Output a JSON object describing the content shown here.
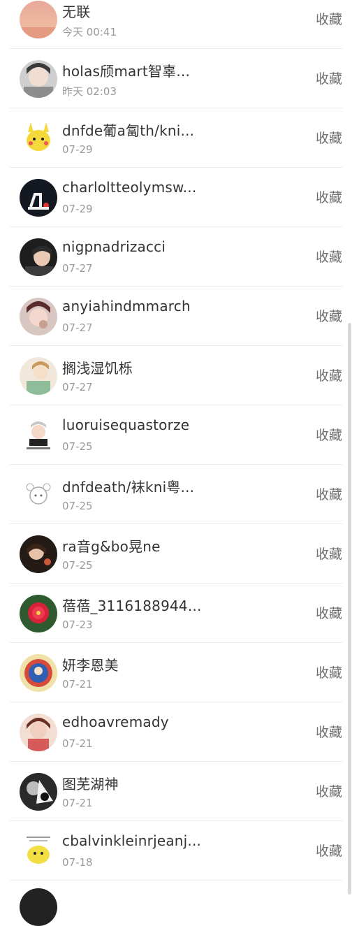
{
  "contacts": [
    {
      "name": "无联",
      "time": "今天 00:41",
      "action": "收藏"
    },
    {
      "name": "holas颀mart智辜...",
      "time": "昨天 02:03",
      "action": "收藏"
    },
    {
      "name": "dnfde葡a匐th/kni...",
      "time": "07-29",
      "action": "收藏"
    },
    {
      "name": "charloltteolymsw...",
      "time": "07-29",
      "action": "收藏"
    },
    {
      "name": "nigpnadrizacci",
      "time": "07-27",
      "action": "收藏"
    },
    {
      "name": "anyiahindmmarch",
      "time": "07-27",
      "action": "收藏"
    },
    {
      "name": "搁浅湿饥栎",
      "time": "07-27",
      "action": "收藏"
    },
    {
      "name": "luoruisequastorze",
      "time": "07-25",
      "action": "收藏"
    },
    {
      "name": "dnfdeath/袜kni粤...",
      "time": "07-25",
      "action": "收藏"
    },
    {
      "name": "ra音g&bo晃ne",
      "time": "07-25",
      "action": "收藏"
    },
    {
      "name": "蓓蓓_3116188944...",
      "time": "07-23",
      "action": "收藏"
    },
    {
      "name": "妍李恩美",
      "time": "07-21",
      "action": "收藏"
    },
    {
      "name": "edhoavremady",
      "time": "07-21",
      "action": "收藏"
    },
    {
      "name": "图芜湖神",
      "time": "07-21",
      "action": "收藏"
    },
    {
      "name": "cbalvinkleinrjeanj...",
      "time": "07-18",
      "action": "收藏"
    }
  ],
  "colors": {
    "name": "#333333",
    "time": "#9a9a9a",
    "action": "#707070",
    "divider": "#ececec"
  }
}
